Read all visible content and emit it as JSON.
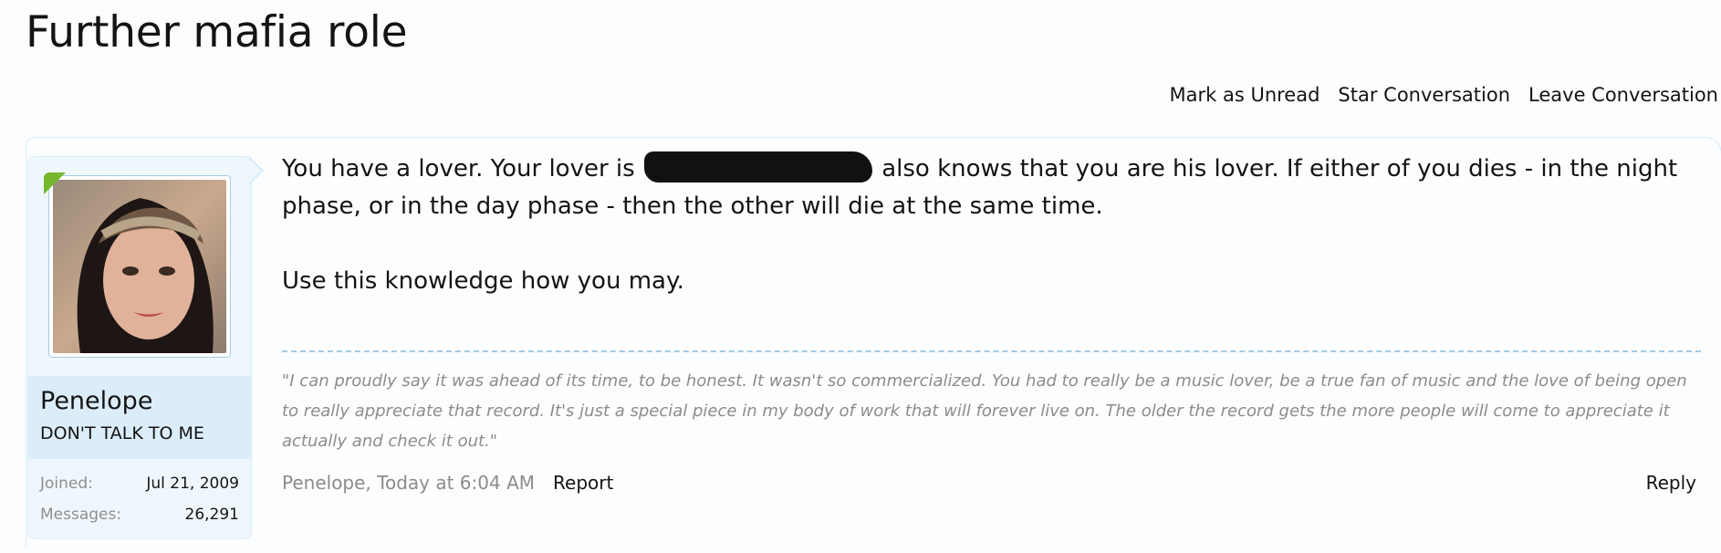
{
  "page": {
    "title": "Further mafia role"
  },
  "actions": [
    {
      "label": "Mark as Unread"
    },
    {
      "label": "Star Conversation"
    },
    {
      "label": "Leave Conversation"
    }
  ],
  "user": {
    "name": "Penelope",
    "title": "DON'T TALK TO ME",
    "avatar_icon": "user-avatar-photo",
    "online_indicator_color": "#75b72d",
    "stats": [
      {
        "label": "Joined:",
        "value": "Jul 21, 2009"
      },
      {
        "label": "Messages:",
        "value": "26,291"
      }
    ]
  },
  "message": {
    "paragraph1_before": "You have a lover. Your lover is ",
    "paragraph1_after": " also knows that you are his lover. If either of you dies - in the night phase, or in the day phase - then the other will die at the same time.",
    "paragraph2": "Use this knowledge how you may."
  },
  "signature": {
    "text": "\"I can proudly say it was ahead of its time, to be honest. It wasn't so commercialized. You had to really be a music lover, be a true fan of music and the love of being open to really appreciate that record. It's just a special piece in my body of work that will forever live on. The older the record gets the more people will come to appreciate it actually and check it out.\""
  },
  "meta": {
    "author_time": "Penelope, Today at 6:04 AM",
    "report_label": "Report",
    "reply_label": "Reply"
  },
  "colors": {
    "card_background": "#f0f7fc",
    "user_info_background": "#dcedfa",
    "border": "#d7edfc",
    "muted_text": "#8c8c8c"
  }
}
